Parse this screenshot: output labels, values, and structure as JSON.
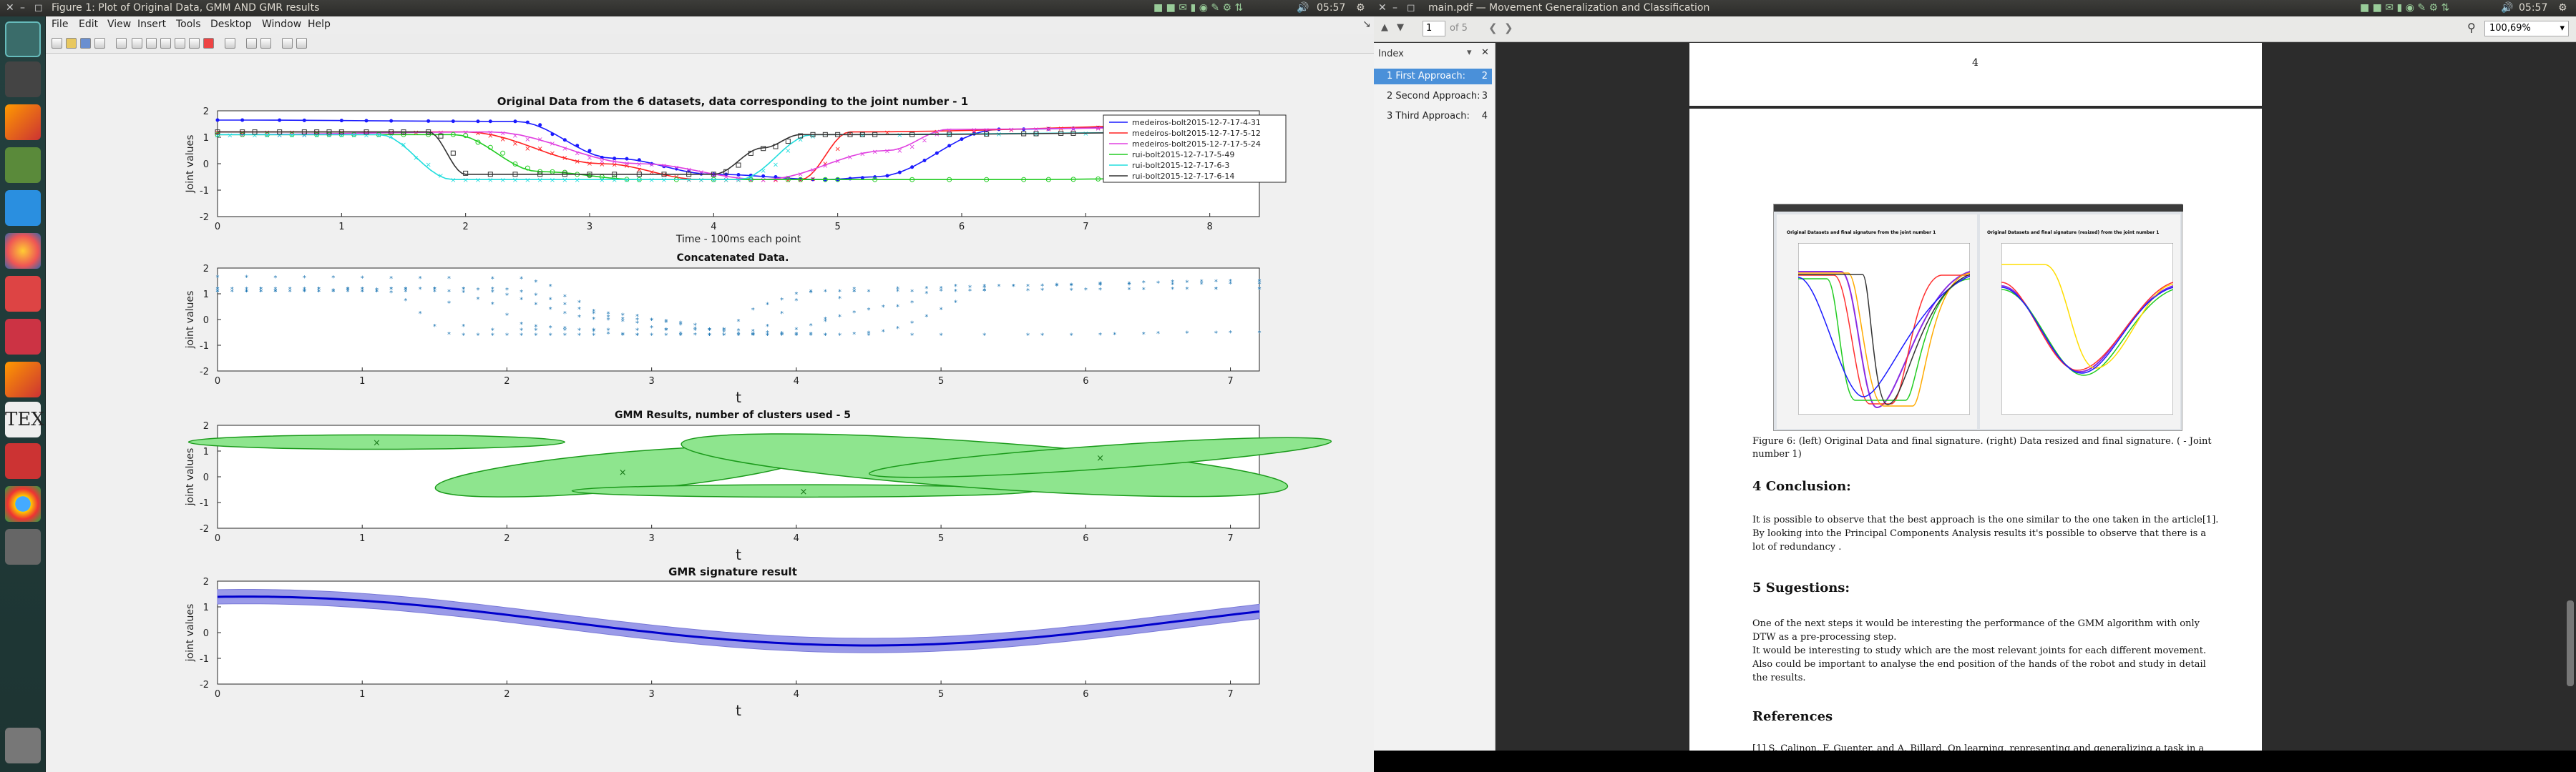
{
  "panel_left": {
    "title": "Figure 1: Plot of Original Data, GMM AND GMR results",
    "time": "05:57"
  },
  "panel_right": {
    "title": "main.pdf — Movement Generalization and Classification",
    "time": "05:57"
  },
  "menu": [
    "File",
    "Edit",
    "View",
    "Insert",
    "Tools",
    "Desktop",
    "Window",
    "Help"
  ],
  "figure": {
    "plot1": {
      "title": "Original Data from the 6 datasets, data corresponding to the joint number -  1",
      "xlabel": "Time - 100ms each point",
      "ylabel": "Joint values",
      "xticks": [
        "0",
        "1",
        "2",
        "3",
        "4",
        "5",
        "6",
        "7",
        "8"
      ],
      "yticks": [
        "2",
        "1",
        "0",
        "-1",
        "-2"
      ],
      "legend": [
        "medeiros-bolt2015-12-7-17-4-31",
        "medeiros-bolt2015-12-7-17-5-12",
        "medeiros-bolt2015-12-7-17-5-24",
        "rui-bolt2015-12-7-17-5-49",
        "rui-bolt2015-12-7-17-6-3",
        "rui-bolt2015-12-7-17-6-14"
      ],
      "colors": [
        "#1a1aff",
        "#ff2020",
        "#e040e0",
        "#22cc22",
        "#22dddd",
        "#333333"
      ]
    },
    "plot2": {
      "title": "Concatenated Data.",
      "xlabel": "t",
      "ylabel": "joint values",
      "xticks": [
        "0",
        "1",
        "2",
        "3",
        "4",
        "5",
        "6",
        "7"
      ],
      "yticks": [
        "2",
        "1",
        "0",
        "-1",
        "-2"
      ]
    },
    "plot3": {
      "title": "GMM Results, number of clusters used -  5",
      "xlabel": "t",
      "ylabel": "joint values",
      "xticks": [
        "0",
        "1",
        "2",
        "3",
        "4",
        "5",
        "6",
        "7"
      ],
      "yticks": [
        "2",
        "1",
        "0",
        "-1",
        "-2"
      ]
    },
    "plot4": {
      "title": "GMR signature result",
      "xlabel": "t",
      "ylabel": "joint values",
      "xticks": [
        "0",
        "1",
        "2",
        "3",
        "4",
        "5",
        "6",
        "7"
      ],
      "yticks": [
        "2",
        "1",
        "0",
        "-1",
        "-2"
      ]
    }
  },
  "pdf": {
    "page_field": "1",
    "page_of": "of 5",
    "zoom": "100,69%",
    "sidebar_title": "Index",
    "index": [
      {
        "label": "1 First Approach:",
        "page": "2"
      },
      {
        "label": "2 Second Approach:",
        "page": "3"
      },
      {
        "label": "3 Third Approach:",
        "page": "4"
      }
    ],
    "page_number": "4",
    "caption1": "Figure 6: (left) Original Data and final signature. (right) Data resized and final signature. ( - Joint",
    "caption2": "number 1)",
    "thumb_left_title": "Original Datasets and final signature from the joint number  1",
    "thumb_right_title": "Original Datasets and final signature (resized) from the joint number  1",
    "sec4": "4    Conclusion:",
    "conc1": "It is possible to observe that the best approach is the one similar to the one taken in the article[1].",
    "conc2": "By looking into the Principal Components Analysis results it's possible to observe that there is a",
    "conc3": "lot of redundancy .",
    "sec5": "5    Sugestions:",
    "sug1": "One of the next steps it would be interesting the performance of the GMM algorithm with only",
    "sug2": "DTW as a pre-processing step.",
    "sug3": "It would be interesting to study which are the most relevant joints for each different movement.",
    "sug4": "Also could be important to analyse the end position of the hands of the robot and study in detail",
    "sug5": "the results.",
    "refs": "References",
    "ref1": "[1] S. Calinon, F. Guenter, and A. Billard. On learning, representing and generalizing a task in a"
  }
}
